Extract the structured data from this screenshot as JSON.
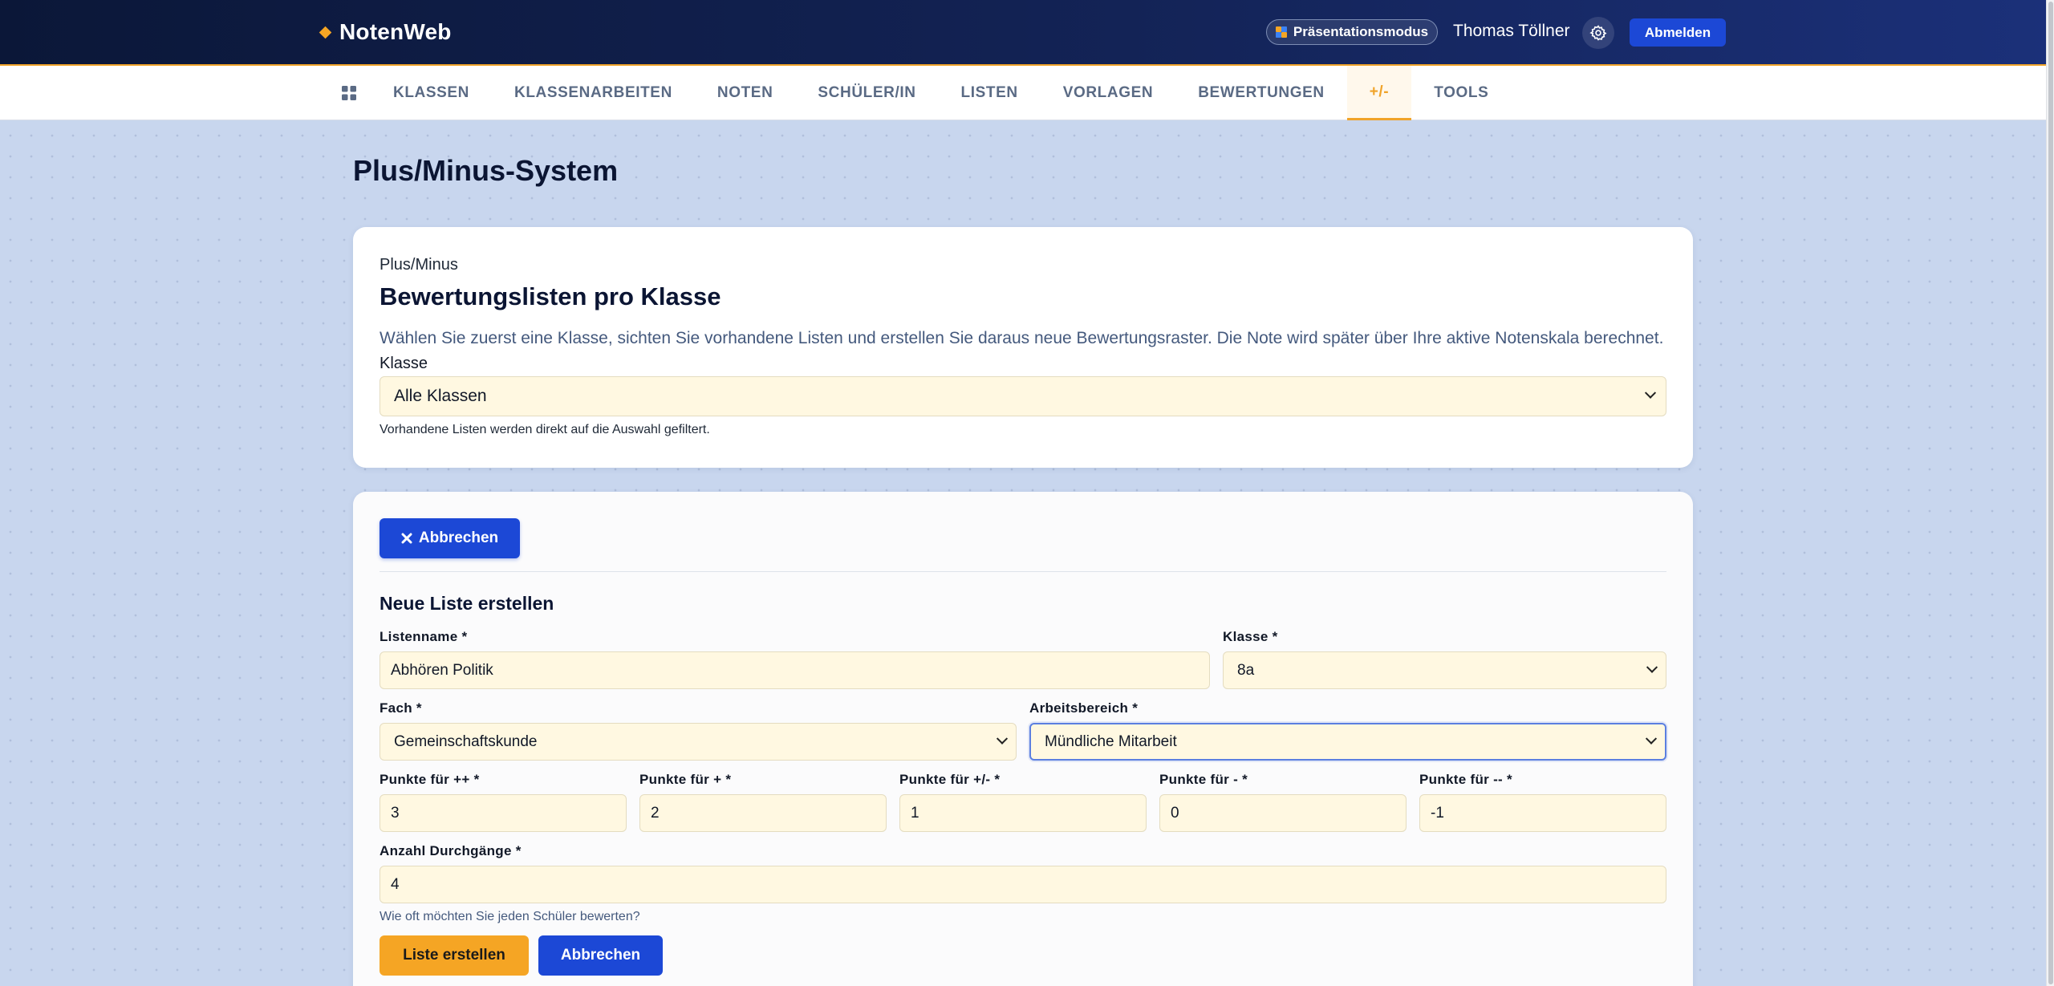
{
  "header": {
    "brand": "NotenWeb",
    "presentation_mode": "Präsentationsmodus",
    "user_name": "Thomas Töllner",
    "logout": "Abmelden"
  },
  "nav": {
    "items": [
      "KLASSEN",
      "KLASSENARBEITEN",
      "NOTEN",
      "SCHÜLER/IN",
      "LISTEN",
      "VORLAGEN",
      "BEWERTUNGEN",
      "+/-",
      "TOOLS"
    ],
    "active": "+/-"
  },
  "page": {
    "title": "Plus/Minus-System"
  },
  "class_card": {
    "eyebrow": "Plus/Minus",
    "title": "Bewertungslisten pro Klasse",
    "description": "Wählen Sie zuerst eine Klasse, sichten Sie vorhandene Listen und erstellen Sie daraus neue Bewertungsraster. Die Note wird später über Ihre aktive Notenskala berechnet.",
    "class_label": "Klasse",
    "class_value": "Alle Klassen",
    "hint": "Vorhandene Listen werden direkt auf die Auswahl gefiltert."
  },
  "form": {
    "cancel_top": "Abbrechen",
    "title": "Neue Liste erstellen",
    "listname_label": "Listenname *",
    "listname_value": "Abhören Politik",
    "klasse_label": "Klasse *",
    "klasse_value": "8a",
    "fach_label": "Fach *",
    "fach_value": "Gemeinschaftskunde",
    "bereich_label": "Arbeitsbereich *",
    "bereich_value": "Mündliche Mitarbeit",
    "points": [
      {
        "label": "Punkte für ++ *",
        "value": "3"
      },
      {
        "label": "Punkte für + *",
        "value": "2"
      },
      {
        "label": "Punkte für +/- *",
        "value": "1"
      },
      {
        "label": "Punkte für - *",
        "value": "0"
      },
      {
        "label": "Punkte für -- *",
        "value": "-1"
      }
    ],
    "rounds_label": "Anzahl Durchgänge *",
    "rounds_value": "4",
    "rounds_hint": "Wie oft möchten Sie jeden Schüler bewerten?",
    "submit": "Liste erstellen",
    "cancel": "Abbrechen"
  },
  "colors": {
    "header_dark": "#0b1738",
    "accent_orange": "#f5a524",
    "primary_blue": "#1c48d6",
    "input_bg": "#fff8e1",
    "page_bg": "#c8d6ee"
  }
}
